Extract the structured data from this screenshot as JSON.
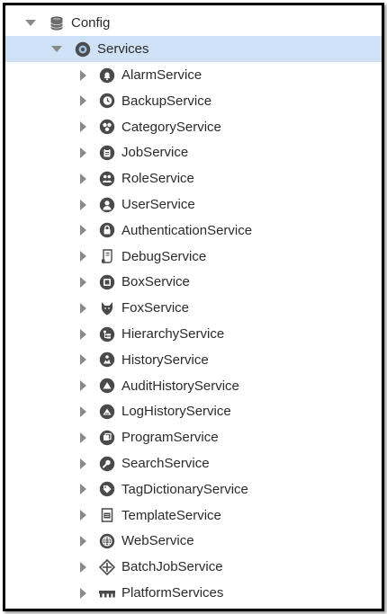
{
  "tree": {
    "root": {
      "label": "Config",
      "icon": "database-icon",
      "expanded": true
    },
    "group": {
      "label": "Services",
      "icon": "services-gear-icon",
      "expanded": true,
      "selected": true
    },
    "services": [
      {
        "label": "AlarmService",
        "icon": "alarm-bell-icon"
      },
      {
        "label": "BackupService",
        "icon": "backup-clock-icon"
      },
      {
        "label": "CategoryService",
        "icon": "category-icon"
      },
      {
        "label": "JobService",
        "icon": "job-icon"
      },
      {
        "label": "RoleService",
        "icon": "role-icon"
      },
      {
        "label": "UserService",
        "icon": "user-icon"
      },
      {
        "label": "AuthenticationService",
        "icon": "lock-icon"
      },
      {
        "label": "DebugService",
        "icon": "scroll-icon"
      },
      {
        "label": "BoxService",
        "icon": "box-icon"
      },
      {
        "label": "FoxService",
        "icon": "fox-icon"
      },
      {
        "label": "HierarchyService",
        "icon": "hierarchy-icon"
      },
      {
        "label": "HistoryService",
        "icon": "history-icon"
      },
      {
        "label": "AuditHistoryService",
        "icon": "audit-history-icon"
      },
      {
        "label": "LogHistoryService",
        "icon": "log-history-icon"
      },
      {
        "label": "ProgramService",
        "icon": "program-icon"
      },
      {
        "label": "SearchService",
        "icon": "search-icon"
      },
      {
        "label": "TagDictionaryService",
        "icon": "tag-icon"
      },
      {
        "label": "TemplateService",
        "icon": "template-icon"
      },
      {
        "label": "WebService",
        "icon": "globe-icon"
      },
      {
        "label": "BatchJobService",
        "icon": "batch-job-icon"
      },
      {
        "label": "PlatformServices",
        "icon": "platform-icon"
      }
    ]
  },
  "colors": {
    "selection": "#cfe1f5",
    "icon": "#4a4a4a",
    "text": "#2b2b2b",
    "arrow": "#8a8a8a"
  }
}
